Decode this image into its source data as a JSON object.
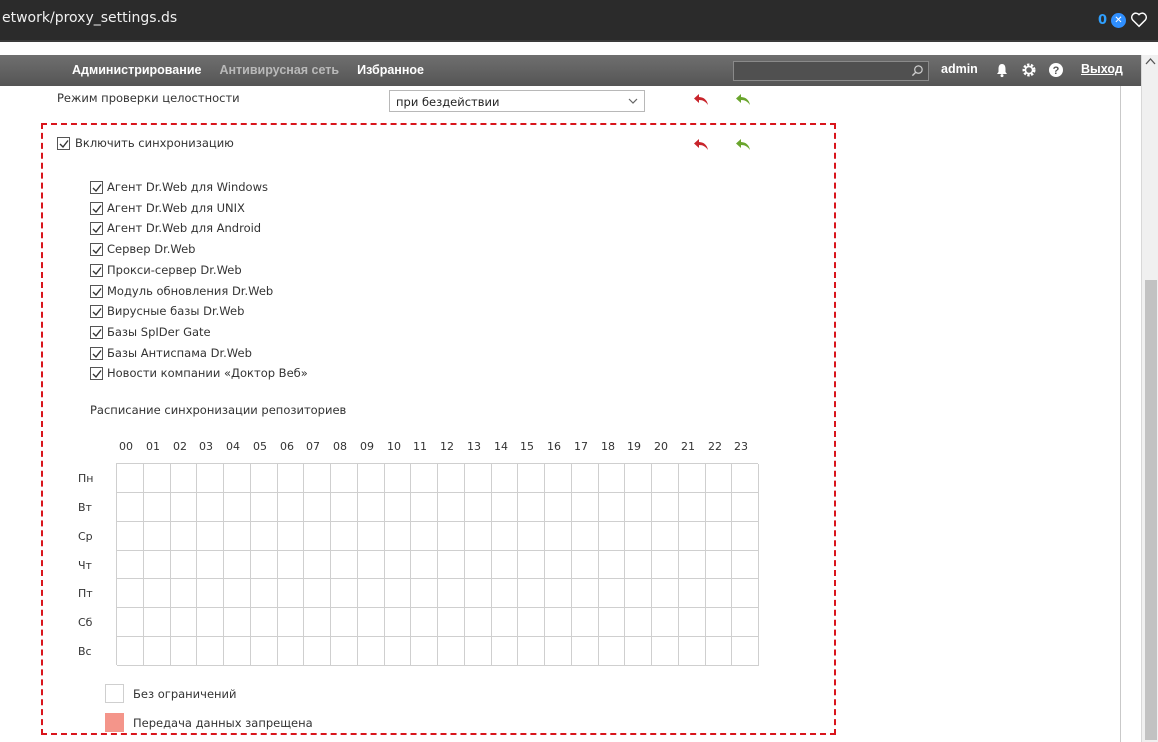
{
  "browser": {
    "url": "etwork/proxy_settings.ds",
    "badge_count": "0"
  },
  "nav": {
    "items": [
      "Администрирование",
      "Антивирусная сеть",
      "Избранное"
    ],
    "search_placeholder": "",
    "user": "admin",
    "exit_label": "Выход"
  },
  "integrity": {
    "label": "Режим проверки целостности",
    "value": "при бездействии"
  },
  "sync": {
    "enable_label": "Включить синхронизацию",
    "enabled": true,
    "components": [
      {
        "label": "Агент Dr.Web для Windows",
        "checked": true
      },
      {
        "label": "Агент Dr.Web для UNIX",
        "checked": true
      },
      {
        "label": "Агент Dr.Web для Android",
        "checked": true
      },
      {
        "label": "Сервер Dr.Web",
        "checked": true
      },
      {
        "label": "Прокси-сервер Dr.Web",
        "checked": true
      },
      {
        "label": "Модуль обновления Dr.Web",
        "checked": true
      },
      {
        "label": "Вирусные базы Dr.Web",
        "checked": true
      },
      {
        "label": "Базы SpIDer Gate",
        "checked": true
      },
      {
        "label": "Базы Антиспама Dr.Web",
        "checked": true
      },
      {
        "label": "Новости компании «Доктор Веб»",
        "checked": true
      }
    ],
    "schedule_title": "Расписание синхронизации репозиториев",
    "hours": [
      "00",
      "01",
      "02",
      "03",
      "04",
      "05",
      "06",
      "07",
      "08",
      "09",
      "10",
      "11",
      "12",
      "13",
      "14",
      "15",
      "16",
      "17",
      "18",
      "19",
      "20",
      "21",
      "22",
      "23"
    ],
    "days": [
      "Пн",
      "Вт",
      "Ср",
      "Чт",
      "Пт",
      "Сб",
      "Вс"
    ]
  },
  "legend": {
    "unrestricted": "Без ограничений",
    "forbidden": "Передача данных запрещена"
  },
  "colors": {
    "highlight": "#d9151c",
    "undo_red": "#c8242b",
    "redo_green": "#6aa52d",
    "forbidden": "#f4958a"
  }
}
